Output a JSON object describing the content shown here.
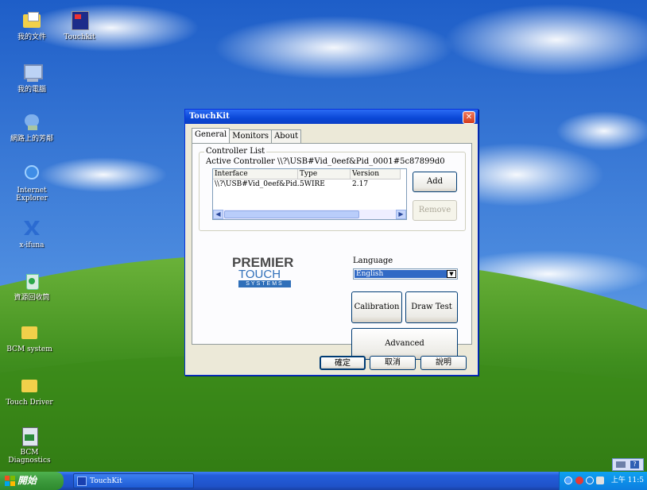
{
  "desktop": {
    "icons": [
      {
        "label": "我的文件"
      },
      {
        "label": "Touchkit"
      },
      {
        "label": "我的電腦"
      },
      {
        "label": "網路上的芳鄰"
      },
      {
        "label": "Internet Explorer"
      },
      {
        "label": "x-ifuna"
      },
      {
        "label": "資源回收筒"
      },
      {
        "label": "BCM system"
      },
      {
        "label": "Touch Driver"
      },
      {
        "label": "BCM Diagnostics"
      }
    ]
  },
  "dialog": {
    "title": "TouchKit",
    "tabs": [
      {
        "label": "General"
      },
      {
        "label": "Monitors"
      },
      {
        "label": "About"
      }
    ],
    "group_label": "Controller List",
    "active_controller_label": "Active Controller",
    "active_controller_value": "\\\\?\\USB#Vid_0eef&Pid_0001#5c87899d0",
    "list": {
      "columns": [
        "Interface",
        "Type",
        "Version"
      ],
      "rows": [
        {
          "interface": "\\\\?\\USB#Vid_0eef&Pid...",
          "type": "5WIRE",
          "version": "2.17"
        }
      ]
    },
    "buttons": {
      "add": "Add",
      "remove": "Remove",
      "calibration": "Calibration",
      "draw_test": "Draw Test",
      "advanced": "Advanced",
      "ok": "確定",
      "cancel": "取消",
      "help": "說明"
    },
    "logo": {
      "line1": "PREMIER",
      "line2": "TOUCH",
      "line3": "SYSTEMS"
    },
    "language_label": "Language",
    "language_value": "English"
  },
  "taskbar": {
    "start_label": "開始",
    "task_item": "TouchKit",
    "clock": "上午 11:5"
  },
  "colors": {
    "title_blue": "#0a47d6",
    "dialog_bg": "#ece9d8",
    "taskbar_blue": "#245edb",
    "start_green": "#3c9a3c"
  }
}
